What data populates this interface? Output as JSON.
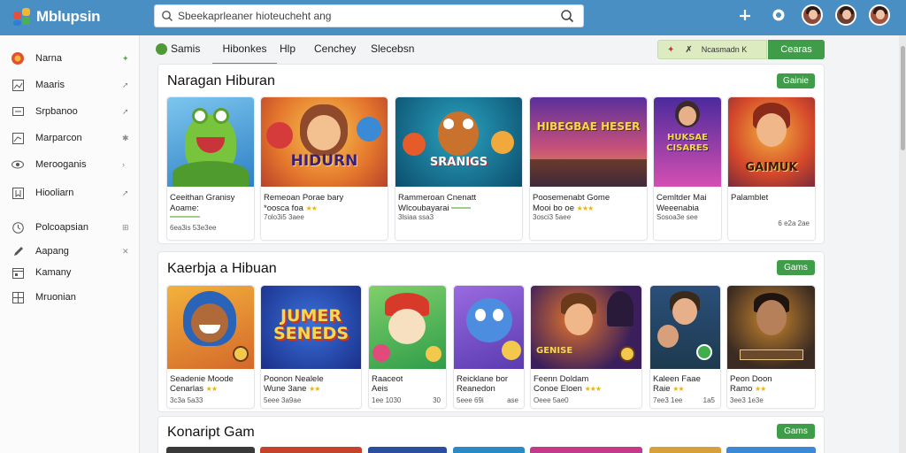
{
  "app": {
    "logo_text": "Mblupsin"
  },
  "search": {
    "placeholder": "Sbeekaprleaner hioteucheht ang"
  },
  "sidebar": {
    "items": [
      {
        "label": "Narna",
        "icon": "games-icon"
      },
      {
        "label": "Maaris",
        "icon": "image-icon"
      },
      {
        "label": "Srpbanoo",
        "icon": "monitor-icon"
      },
      {
        "label": "Marparcon",
        "icon": "chart-icon"
      },
      {
        "label": "Merooganis",
        "icon": "eye-icon"
      },
      {
        "label": "Hiooliarn",
        "icon": "bookmark-icon"
      },
      {
        "label": "Polcoapsian",
        "icon": "clock-icon"
      },
      {
        "label": "Aapang",
        "icon": "edit-icon"
      },
      {
        "label": "Kamany",
        "icon": "calendar-icon"
      },
      {
        "label": "Mruonian",
        "icon": "grid-icon"
      }
    ]
  },
  "tabs": [
    {
      "label": "Samis"
    },
    {
      "label": "Hibonkes"
    },
    {
      "label": "Hlp"
    },
    {
      "label": "Cenchey"
    },
    {
      "label": "Slecebsn"
    }
  ],
  "filter": {
    "label": "Ncasmadn K",
    "button": "Cearas"
  },
  "sections": [
    {
      "title": "Naragan Hiburan",
      "button": "Gainie",
      "cards": [
        {
          "title": "Ceeithan Granisy",
          "subtitle": "Aoame:",
          "meta": "6ea3is 53e3ee",
          "meta_right": "",
          "art": "",
          "colors": [
            "#3c8fcf",
            "#7fc8f0"
          ]
        },
        {
          "title": "Remeoan Porae bary",
          "subtitle": "*oosca foa",
          "meta": "7olo3i5 3aee",
          "meta_right": "",
          "art": "HIDURN",
          "colors": [
            "#e7842a",
            "#c64a2e"
          ]
        },
        {
          "title": "Rammeroan Cnenatt",
          "subtitle": "Wlcoubayarai",
          "meta": "3lsiaa ssa3",
          "meta_right": "",
          "art": "SRANIGS",
          "colors": [
            "#0f6c8a",
            "#d54d2a"
          ]
        },
        {
          "title": "Poosemenabt Gome",
          "subtitle": "Mooi bo oe",
          "meta": "3osci3 5aee",
          "meta_right": "",
          "art": "HIBEGBAE HESER",
          "colors": [
            "#7b3fa8",
            "#e08636"
          ]
        },
        {
          "title": "Cemltder Mai",
          "subtitle": "Weeenabia",
          "meta": "Sosoa3e see",
          "meta_right": "",
          "art": "HUKSAE CISARES",
          "colors": [
            "#6c3eb2",
            "#e25bb4"
          ]
        },
        {
          "title": "Palamblet",
          "subtitle": "",
          "meta": "",
          "meta_right": "6 e2a 2ae",
          "art": "GAIMUK",
          "colors": [
            "#c95124",
            "#f3a23a"
          ]
        }
      ]
    },
    {
      "title": "Kaerbja a Hibuan",
      "button": "Gams",
      "cards": [
        {
          "title": "Seadenie Moode",
          "subtitle": "Cenarlas",
          "meta": "3c3a 5a33",
          "meta_right": "",
          "art": "",
          "colors": [
            "#2a6fc0",
            "#f5a43a"
          ]
        },
        {
          "title": "Poonon Nealele",
          "subtitle": "Wune 3ane",
          "meta": "5eee 3a9ae",
          "meta_right": "",
          "art": "JUMER SENEDS",
          "colors": [
            "#1f4fb5",
            "#e53d2e"
          ]
        },
        {
          "title": "Raaceot",
          "subtitle": "Aeis",
          "meta": "1ee 1030",
          "meta_right": "30",
          "art": "",
          "colors": [
            "#2f9d4a",
            "#cfe3a0"
          ]
        },
        {
          "title": "Reicklane bor",
          "subtitle": "Reanedon",
          "meta": "5eee 69i",
          "meta_right": "ase",
          "art": "",
          "colors": [
            "#7a4fd0",
            "#a5d6f5"
          ]
        },
        {
          "title": "Feenn Doldam",
          "subtitle": "Conoe Eloen",
          "meta": "Oeee 5ae0",
          "meta_right": "",
          "art": "GENISE",
          "colors": [
            "#3a1f5c",
            "#e3742a"
          ]
        },
        {
          "title": "Kaleen Faae",
          "subtitle": "Raie",
          "meta": "7ee3 1ee",
          "meta_right": "1a5",
          "art": "",
          "colors": [
            "#1d5b6e",
            "#2f3f6e"
          ]
        },
        {
          "title": "Peon Doon",
          "subtitle": "Ramo",
          "meta": "3ee3 1e3e",
          "meta_right": "",
          "art": "",
          "colors": [
            "#3b2b22",
            "#c9862e"
          ]
        }
      ]
    },
    {
      "title": "Konaript Gam",
      "button": "Gams",
      "cards": []
    }
  ]
}
